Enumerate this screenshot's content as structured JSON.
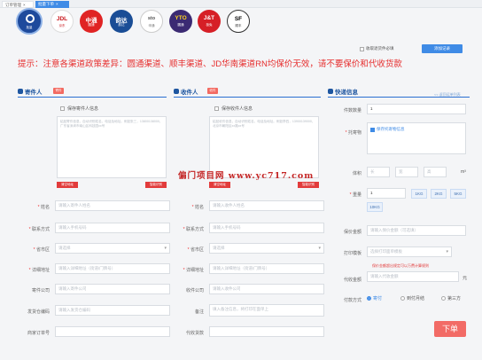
{
  "tabs": [
    {
      "label": "订单管理",
      "close": "×",
      "active": false
    },
    {
      "label": "批量下单",
      "close": "×",
      "active": true
    }
  ],
  "carriers": [
    {
      "name": "jd-default",
      "logo": "",
      "sub": "批量"
    },
    {
      "name": "jdl",
      "logo": "JDL",
      "sub": "京东"
    },
    {
      "name": "zto",
      "logo": "中通",
      "sub": "圆通"
    },
    {
      "name": "yunda",
      "logo": "韵达",
      "sub": "韵达"
    },
    {
      "name": "sto",
      "logo": "sto",
      "sub": "申通"
    },
    {
      "name": "yto",
      "logo": "YTO",
      "sub": "圆通"
    },
    {
      "name": "jt",
      "logo": "J&T",
      "sub": "极兔"
    },
    {
      "name": "sf",
      "logo": "SF",
      "sub": "顺丰"
    }
  ],
  "top": {
    "record_check": "收取退货件必填",
    "record_button": "添加记录"
  },
  "notice": "提示：注意各渠道政策差异：圆通渠道、顺丰渠道、JD华南渠道RN均保价无效，请不要保价和代收货款",
  "sender": {
    "title": "寄件人",
    "tag": "寄件",
    "save_label": "保存寄件人信息",
    "paste_placeholder": "粘贴寄件信息，自动识别姓名、电话及地址。例如张三，13800138000，广东省深圳市南山区科技园xx号",
    "clear_btn": "清空地址",
    "parse_btn": "智能识别",
    "fields": [
      {
        "label": "姓名",
        "required": true,
        "placeholder": "请输入寄件人姓名",
        "select": false
      },
      {
        "label": "联系方式",
        "required": true,
        "placeholder": "请输入手机号码",
        "select": false
      },
      {
        "label": "省市区",
        "required": true,
        "placeholder": "请选择",
        "select": true
      },
      {
        "label": "详细地址",
        "required": true,
        "placeholder": "请输入详细地址（街道/门牌号）",
        "select": false
      },
      {
        "label": "寄件公司",
        "required": false,
        "placeholder": "请输入寄件公司",
        "select": false
      },
      {
        "label": "发货仓编码",
        "required": false,
        "placeholder": "请输入发货仓编码",
        "select": false
      },
      {
        "label": "商家订单号",
        "required": false,
        "placeholder": "",
        "select": false
      }
    ]
  },
  "receiver": {
    "title": "收件人",
    "tag": "收件",
    "save_label": "保存收件人信息",
    "paste_placeholder": "粘贴收件信息，自动识别姓名、电话及地址。例如李四，13900139000，北京市朝阳区xx路xx号",
    "clear_btn": "清空地址",
    "parse_btn": "智能识别",
    "fields": [
      {
        "label": "姓名",
        "required": true,
        "placeholder": "请输入收件人姓名",
        "select": false
      },
      {
        "label": "联系方式",
        "required": true,
        "placeholder": "请输入手机号码",
        "select": false
      },
      {
        "label": "省市区",
        "required": true,
        "placeholder": "请选择",
        "select": true
      },
      {
        "label": "详细地址",
        "required": true,
        "placeholder": "请输入详细地址（街道/门牌号）",
        "select": false
      },
      {
        "label": "收件公司",
        "required": false,
        "placeholder": "请输入收件公司",
        "select": false
      },
      {
        "label": "备注",
        "required": false,
        "placeholder": "填入备注信息，将打印在面单上",
        "select": false
      },
      {
        "label": "代收货款",
        "required": false,
        "placeholder": "",
        "select": false
      }
    ]
  },
  "express": {
    "title": "快递信息",
    "link": "<< 返回运单列表",
    "pieces_label": "件数数量",
    "pieces_value": "1",
    "goods_label": "托寄物",
    "goods_option": "保存托寄物信息",
    "volume_label": "体积",
    "volume_ph": [
      "长",
      "宽",
      "高"
    ],
    "volume_unit": "m³",
    "weight_label": "重量",
    "weight_value": "1",
    "weight_opts": [
      "1KG",
      "2KG",
      "5KG",
      "10KG"
    ],
    "insured_label": "保价金额",
    "insured_ph": "请输入保价金额（可选填）",
    "template_label": "打印模板",
    "template_ph": "选择打印面单模板",
    "note": "保价金额超出规定可以万费计算规则",
    "collect_label": "代收金额",
    "collect_ph": "请输入代收金额",
    "collect_unit": "元",
    "pay_label": "付款方式",
    "pay_opts": [
      "寄付",
      "到付月结",
      "第三方"
    ]
  },
  "watermark": "偏门项目网 www.yc717.com",
  "submit": "下单"
}
